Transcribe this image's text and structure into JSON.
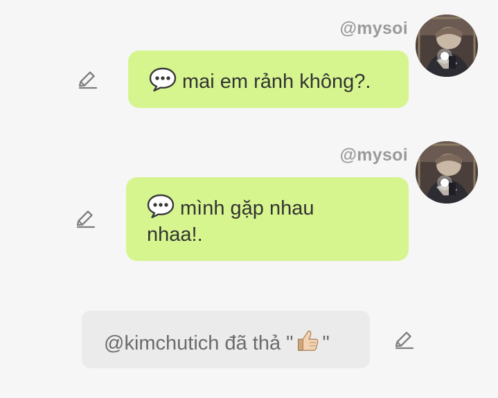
{
  "messages": [
    {
      "username": "@mysoi",
      "text": "mai em rảnh không?.",
      "icon": "speech-balloon-icon"
    },
    {
      "username": "@mysoi",
      "text": "mình gặp nhau nhaa!.",
      "icon": "speech-balloon-icon"
    }
  ],
  "reaction": {
    "prefix": "@kimchutich đã thả \"",
    "emoji": "thumbs-up-icon",
    "suffix": "\""
  },
  "colors": {
    "background": "#f6f6f6",
    "bubble": "#d6f58f",
    "username": "#9a9a9a",
    "reaction_background": "#ebebeb",
    "reaction_text": "#6b6b6b"
  }
}
